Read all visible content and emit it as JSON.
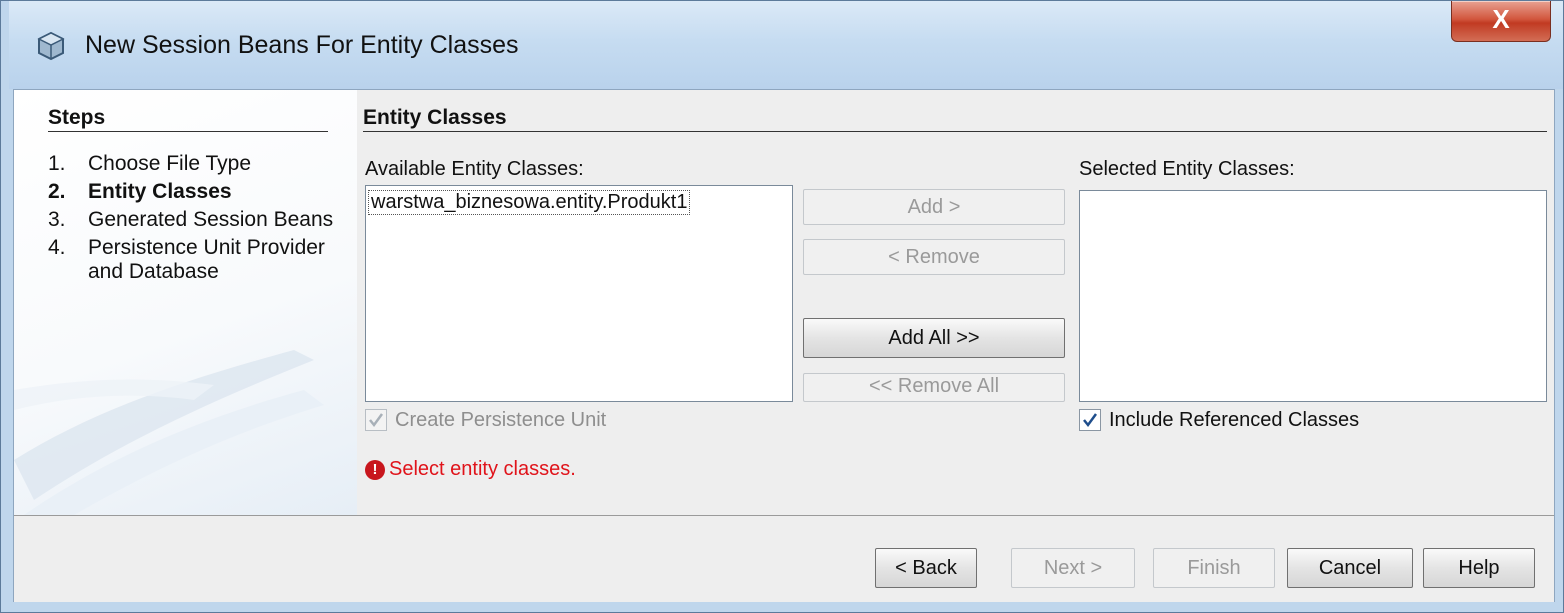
{
  "window": {
    "title": "New Session Beans For Entity Classes",
    "close_label": "X"
  },
  "steps": {
    "title": "Steps",
    "items": [
      {
        "num": "1.",
        "label": "Choose File Type"
      },
      {
        "num": "2.",
        "label": "Entity Classes"
      },
      {
        "num": "3.",
        "label": "Generated Session Beans"
      },
      {
        "num": "4.",
        "label": "Persistence Unit Provider and Database"
      }
    ],
    "active_index": 1
  },
  "main": {
    "title": "Entity Classes",
    "available_label": "Available Entity Classes:",
    "available_items": [
      "warstwa_biznesowa.entity.Produkt1"
    ],
    "selected_label": "Selected Entity Classes:",
    "selected_items": [],
    "buttons": {
      "add": "Add >",
      "remove": "< Remove",
      "add_all": "Add All >>",
      "remove_all": "<< Remove All"
    },
    "create_pu_label": "Create Persistence Unit",
    "create_pu_checked": true,
    "include_ref_label": "Include Referenced Classes",
    "include_ref_checked": true,
    "error_text": "Select entity classes."
  },
  "footer": {
    "back": "< Back",
    "next": "Next >",
    "finish": "Finish",
    "cancel": "Cancel",
    "help": "Help"
  },
  "colors": {
    "error": "#e0131a",
    "panel_bg": "#eeeeee",
    "title_bar": "#c6dcf1"
  }
}
